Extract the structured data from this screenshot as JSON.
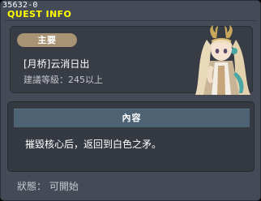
{
  "window": {
    "id_label": "35632-0",
    "title": "QUEST INFO"
  },
  "quest": {
    "category_badge": "主要",
    "name": "[月桥]云消日出",
    "requirement": "建議等級：245以上"
  },
  "content": {
    "header": "內容",
    "description": "摧毀核心后，返回到白色之矛。"
  },
  "status": {
    "text": "狀態： 可開始"
  },
  "npc": {
    "portrait_icon": "npc-portrait-long-blonde-hair-antlers"
  },
  "colors": {
    "title": "#ffff00",
    "window_bg": "#444a56",
    "badge_bg": "#a89375",
    "header_bg": "#4d6272"
  }
}
